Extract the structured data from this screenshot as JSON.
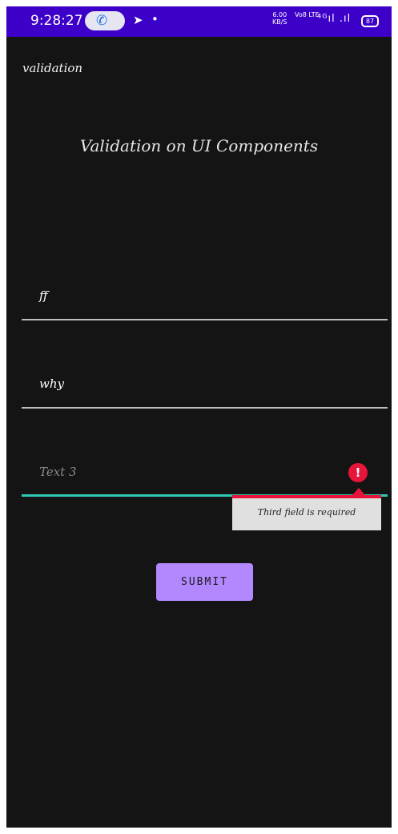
{
  "status_bar": {
    "time": "9:28:27",
    "net_speed_value": "6.00",
    "net_speed_unit": "KB/S",
    "volte": "Vo8 LTE",
    "battery": "87",
    "icons": [
      "call-icon",
      "send-icon",
      "dot-icon",
      "signal-icon",
      "battery-icon"
    ]
  },
  "app": {
    "title": "validation",
    "heading": "Validation on UI Components"
  },
  "form": {
    "field1": {
      "value": "ff"
    },
    "field2": {
      "value": "why"
    },
    "field3": {
      "value": "",
      "placeholder": "Text 3",
      "error": "Third field is required"
    },
    "submit_label": "SUBMIT"
  },
  "colors": {
    "status_bar": "#3d00c8",
    "background": "#141414",
    "accent": "#30c9b5",
    "error": "#e8153a",
    "button": "#b388ff"
  }
}
